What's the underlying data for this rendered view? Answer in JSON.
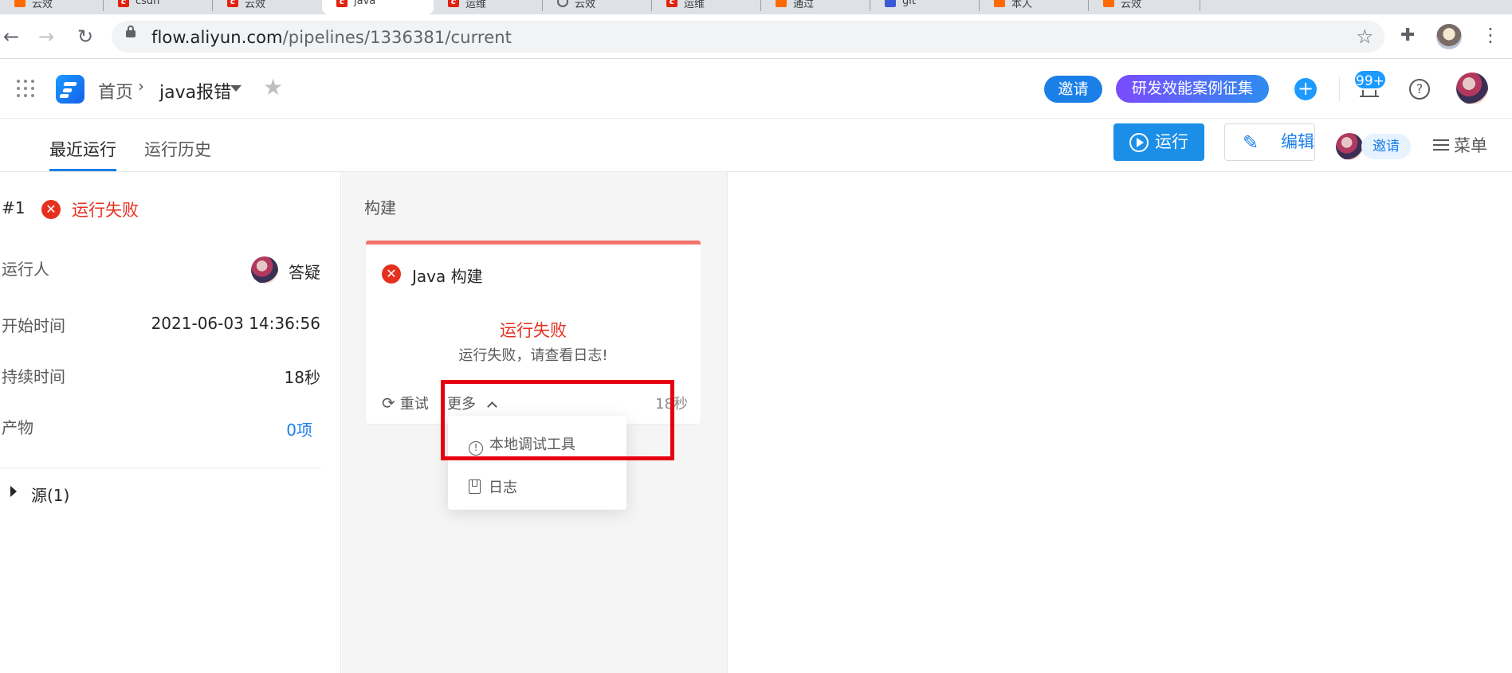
{
  "browser": {
    "tabs": [
      {
        "icon": "aliyun-favicon",
        "title": "云效"
      },
      {
        "icon": "csdn-favicon",
        "title": "csdn"
      },
      {
        "icon": "csdn-favicon",
        "title": "云效"
      },
      {
        "icon": "csdn-favicon",
        "title": "java"
      },
      {
        "icon": "csdn-favicon",
        "title": "运维"
      },
      {
        "icon": "github-favicon",
        "title": "云效"
      },
      {
        "icon": "csdn-favicon",
        "title": "运维"
      },
      {
        "icon": "aliyun-favicon",
        "title": "通过"
      },
      {
        "icon": "baidu-favicon",
        "title": "git"
      },
      {
        "icon": "aliyun-favicon",
        "title": "本人"
      },
      {
        "icon": "aliyun-favicon",
        "title": "云效"
      }
    ],
    "url_host": "flow.aliyun.com",
    "url_path": "/pipelines/1336381/current"
  },
  "header": {
    "breadcrumb_home": "首页",
    "breadcrumb_sep": "›",
    "pipeline_name": "java报错",
    "invite_label": "邀请",
    "collect_label": "研发效能案例征集",
    "notification_count": "99+"
  },
  "subnav": {
    "tabs": [
      {
        "label": "最近运行"
      },
      {
        "label": "运行历史"
      }
    ],
    "run_label": "运行",
    "edit_label": "编辑",
    "invite_label": "邀请",
    "menu_label": "菜单"
  },
  "run": {
    "number": "#1",
    "status": "运行失败",
    "fields": [
      {
        "label": "运行人",
        "value": "答疑"
      },
      {
        "label": "开始时间",
        "value": "2021-06-03 14:36:56"
      },
      {
        "label": "持续时间",
        "value": "18秒"
      },
      {
        "label": "产物",
        "value": "0项"
      }
    ],
    "source_label": "源(1)"
  },
  "stage": {
    "title": "构建",
    "job": {
      "name": "Java 构建",
      "status": "运行失败",
      "message": "运行失败，请查看日志!",
      "retry_label": "重试",
      "more_label": "更多",
      "duration": "18秒"
    },
    "dropdown": [
      {
        "icon": "exclamation-icon",
        "label": "本地调试工具"
      },
      {
        "icon": "log-book-icon",
        "label": "日志"
      }
    ]
  },
  "colors": {
    "accent": "#1b7fe8",
    "fail": "#e6301f",
    "highlight": "#e60012"
  }
}
